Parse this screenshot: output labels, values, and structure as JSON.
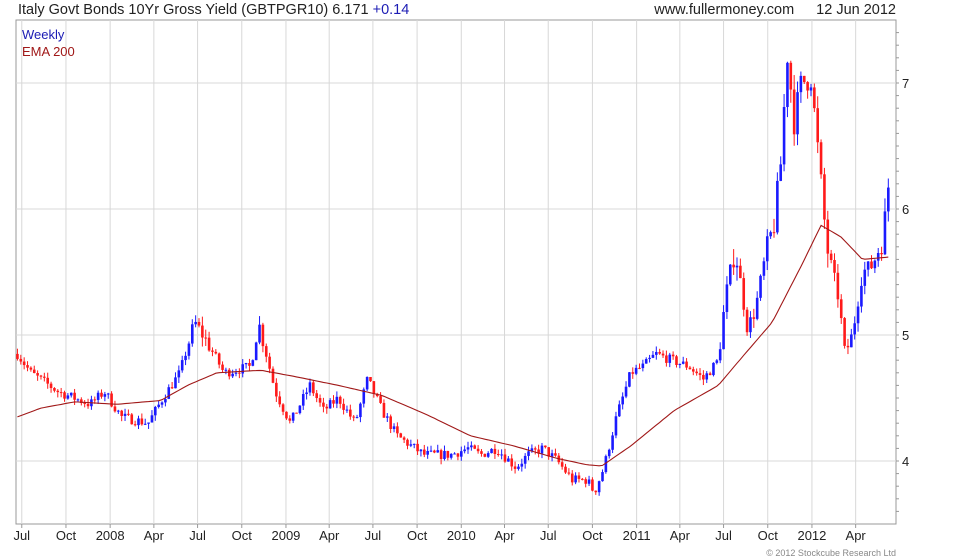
{
  "header": {
    "title": "Italy Govt Bonds 10Yr Gross Yield (GBTPGR10) 6.171",
    "change": "+0.14",
    "site": "www.fullermoney.com",
    "date": "12 Jun 2012"
  },
  "footer": {
    "copyright": "© 2012 Stockcube Research Ltd"
  },
  "colors": {
    "up": "#1a1aff",
    "down": "#ff1a1a",
    "ema": "#a01818",
    "grid": "#d8d8d8"
  },
  "chart_data": {
    "type": "candlestick",
    "legend": [
      "Weekly",
      "EMA 200"
    ],
    "ylim": [
      3.5,
      7.5
    ],
    "y_ticks": [
      4,
      5,
      6,
      7
    ],
    "x_ticks": [
      "Jul",
      "Oct",
      "2008",
      "Apr",
      "Jul",
      "Oct",
      "2009",
      "Apr",
      "Jul",
      "Oct",
      "2010",
      "Apr",
      "Jul",
      "Oct",
      "2011",
      "Apr",
      "Jul",
      "Oct",
      "2012",
      "Apr"
    ],
    "price_anchors": [
      [
        "2007-06-22",
        4.85
      ],
      [
        "2007-07-20",
        4.7
      ],
      [
        "2007-09-15",
        4.55
      ],
      [
        "2007-11-20",
        4.45
      ],
      [
        "2007-12-20",
        4.55
      ],
      [
        "2008-01-25",
        4.35
      ],
      [
        "2008-03-20",
        4.3
      ],
      [
        "2008-04-20",
        4.5
      ],
      [
        "2008-05-25",
        4.7
      ],
      [
        "2008-06-25",
        5.1
      ],
      [
        "2008-07-20",
        4.95
      ],
      [
        "2008-08-25",
        4.7
      ],
      [
        "2008-10-20",
        4.75
      ],
      [
        "2008-11-05",
        5.1
      ],
      [
        "2008-12-10",
        4.55
      ],
      [
        "2009-01-10",
        4.3
      ],
      [
        "2009-02-20",
        4.6
      ],
      [
        "2009-03-20",
        4.4
      ],
      [
        "2009-04-20",
        4.5
      ],
      [
        "2009-05-25",
        4.3
      ],
      [
        "2009-06-20",
        4.65
      ],
      [
        "2009-07-20",
        4.4
      ],
      [
        "2009-08-20",
        4.2
      ],
      [
        "2009-10-15",
        4.05
      ],
      [
        "2009-12-10",
        4.05
      ],
      [
        "2010-01-15",
        4.1
      ],
      [
        "2010-02-10",
        4.05
      ],
      [
        "2010-03-15",
        4.1
      ],
      [
        "2010-04-25",
        3.95
      ],
      [
        "2010-05-20",
        4.05
      ],
      [
        "2010-06-20",
        4.1
      ],
      [
        "2010-07-20",
        4.0
      ],
      [
        "2010-08-20",
        3.85
      ],
      [
        "2010-09-20",
        3.85
      ],
      [
        "2010-10-05",
        3.75
      ],
      [
        "2010-10-25",
        3.95
      ],
      [
        "2010-11-20",
        4.35
      ],
      [
        "2010-12-20",
        4.7
      ],
      [
        "2011-01-15",
        4.75
      ],
      [
        "2011-02-10",
        4.85
      ],
      [
        "2011-03-15",
        4.8
      ],
      [
        "2011-04-20",
        4.75
      ],
      [
        "2011-05-20",
        4.65
      ],
      [
        "2011-06-20",
        4.8
      ],
      [
        "2011-07-05",
        5.3
      ],
      [
        "2011-07-25",
        5.7
      ],
      [
        "2011-08-20",
        5.05
      ],
      [
        "2011-09-05",
        5.2
      ],
      [
        "2011-09-25",
        5.6
      ],
      [
        "2011-10-15",
        5.9
      ],
      [
        "2011-11-01",
        6.5
      ],
      [
        "2011-11-09",
        7.3
      ],
      [
        "2011-11-25",
        6.7
      ],
      [
        "2011-12-10",
        7.0
      ],
      [
        "2011-12-30",
        7.05
      ],
      [
        "2012-01-15",
        6.4
      ],
      [
        "2012-02-01",
        5.7
      ],
      [
        "2012-02-25",
        5.3
      ],
      [
        "2012-03-10",
        4.85
      ],
      [
        "2012-03-25",
        5.0
      ],
      [
        "2012-04-15",
        5.5
      ],
      [
        "2012-05-05",
        5.55
      ],
      [
        "2012-05-25",
        5.75
      ],
      [
        "2012-06-12",
        6.17
      ]
    ],
    "ema_anchors": [
      [
        "2007-06-22",
        4.35
      ],
      [
        "2007-08-10",
        4.42
      ],
      [
        "2007-10-20",
        4.47
      ],
      [
        "2008-01-15",
        4.45
      ],
      [
        "2008-04-15",
        4.48
      ],
      [
        "2008-06-10",
        4.6
      ],
      [
        "2008-08-10",
        4.7
      ],
      [
        "2008-11-10",
        4.72
      ],
      [
        "2009-01-20",
        4.67
      ],
      [
        "2009-04-20",
        4.6
      ],
      [
        "2009-07-20",
        4.52
      ],
      [
        "2009-10-20",
        4.37
      ],
      [
        "2010-01-20",
        4.2
      ],
      [
        "2010-04-20",
        4.12
      ],
      [
        "2010-07-20",
        4.02
      ],
      [
        "2010-09-20",
        3.97
      ],
      [
        "2010-10-20",
        3.96
      ],
      [
        "2010-12-20",
        4.12
      ],
      [
        "2011-03-20",
        4.4
      ],
      [
        "2011-06-20",
        4.6
      ],
      [
        "2011-08-10",
        4.83
      ],
      [
        "2011-10-10",
        5.1
      ],
      [
        "2011-12-10",
        5.55
      ],
      [
        "2012-01-20",
        5.87
      ],
      [
        "2012-03-01",
        5.78
      ],
      [
        "2012-04-15",
        5.6
      ],
      [
        "2012-06-12",
        5.62
      ]
    ]
  }
}
